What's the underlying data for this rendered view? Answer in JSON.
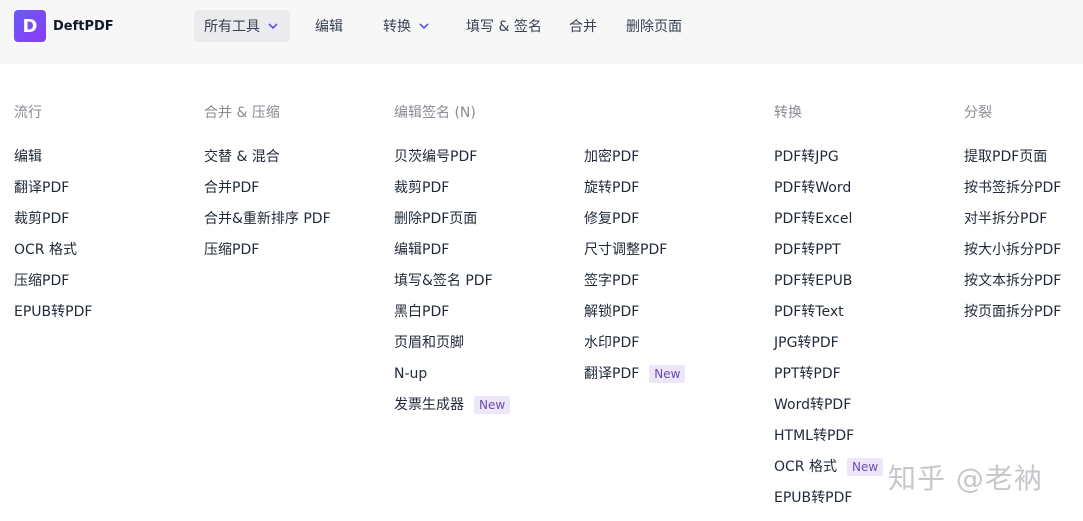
{
  "app": {
    "logo_letter": "D",
    "name": "DeftPDF"
  },
  "nav": {
    "all_tools": "所有工具",
    "edit": "编辑",
    "convert": "转换",
    "fill_sign": "填写 & 签名",
    "merge": "合并",
    "delete_pages": "删除页面"
  },
  "menu": {
    "popular": {
      "heading": "流行",
      "items": [
        "编辑",
        "翻译PDF",
        "裁剪PDF",
        "OCR 格式",
        "压缩PDF",
        "EPUB转PDF"
      ]
    },
    "merge_compress": {
      "heading": "合并 & 压缩",
      "items": [
        "交替 & 混合",
        "合并PDF",
        "合并&重新排序 PDF",
        "压缩PDF"
      ]
    },
    "edit_sign": {
      "heading": "编辑签名 (N)",
      "items": [
        "贝茨编号PDF",
        "裁剪PDF",
        "删除PDF页面",
        "编辑PDF",
        "填写&签名 PDF",
        "黑白PDF",
        "页眉和页脚",
        "N-up",
        "发票生成器"
      ],
      "items2": [
        "加密PDF",
        "旋转PDF",
        "修复PDF",
        "尺寸调整PDF",
        "签字PDF",
        "解锁PDF",
        "水印PDF",
        "翻译PDF"
      ]
    },
    "convert": {
      "heading": "转换",
      "items": [
        "PDF转JPG",
        "PDF转Word",
        "PDF转Excel",
        "PDF转PPT",
        "PDF转EPUB",
        "PDF转Text",
        "JPG转PDF",
        "PPT转PDF",
        "Word转PDF",
        "HTML转PDF",
        "OCR 格式",
        "EPUB转PDF"
      ]
    },
    "split": {
      "heading": "分裂",
      "items": [
        "提取PDF页面",
        "按书签拆分PDF",
        "对半拆分PDF",
        "按大小拆分PDF",
        "按文本拆分PDF",
        "按页面拆分PDF"
      ]
    },
    "badge_new": "New"
  },
  "watermark": "知乎 @老衲",
  "colors": {
    "brand_start": "#6a5af9",
    "brand_end": "#8b3cf4",
    "badge_bg": "#ede6f7",
    "badge_text": "#6d4bb3"
  }
}
